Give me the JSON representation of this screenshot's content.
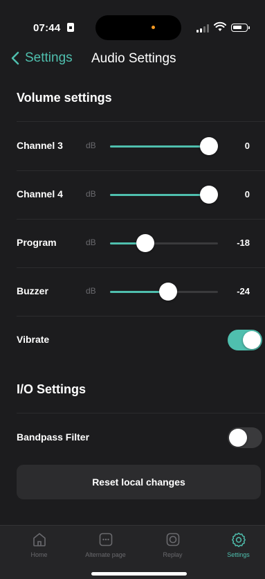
{
  "status_bar": {
    "time": "07:44"
  },
  "nav": {
    "back_label": "Settings",
    "title": "Audio Settings"
  },
  "volume_section": {
    "title": "Volume settings",
    "rows": [
      {
        "label": "Channel 3",
        "unit": "dB",
        "value": "0",
        "level": 0.93
      },
      {
        "label": "Channel 4",
        "unit": "dB",
        "value": "0",
        "level": 0.93
      },
      {
        "label": "Program",
        "unit": "dB",
        "value": "-18",
        "level": 0.33
      },
      {
        "label": "Buzzer",
        "unit": "dB",
        "value": "-24",
        "level": 0.54
      }
    ],
    "vibrate": {
      "label": "Vibrate",
      "on": true
    }
  },
  "io_section": {
    "title": "I/O Settings",
    "bandpass": {
      "label": "Bandpass Filter",
      "on": false
    }
  },
  "reset_label": "Reset local changes",
  "tabs": [
    {
      "label": "Home",
      "icon": "home-icon",
      "active": false
    },
    {
      "label": "Alternate page",
      "icon": "alternate-page-icon",
      "active": false
    },
    {
      "label": "Replay",
      "icon": "replay-icon",
      "active": false
    },
    {
      "label": "Settings",
      "icon": "gear-icon",
      "active": true
    }
  ],
  "colors": {
    "accent": "#4fbfae",
    "background": "#1c1c1e",
    "track": "#3a3a3c",
    "muted": "#6a6a6e"
  }
}
